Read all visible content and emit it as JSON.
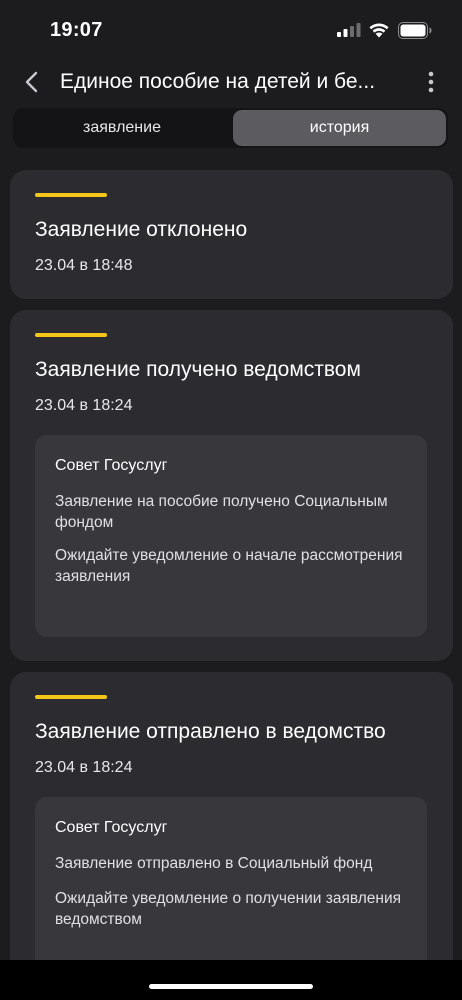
{
  "status_bar": {
    "time": "19:07"
  },
  "header": {
    "title": "Единое пособие на детей и бе...",
    "back_icon": "chevron-left-icon",
    "more_icon": "more-vertical-icon"
  },
  "tabs": [
    {
      "label": "заявление",
      "active": false
    },
    {
      "label": "история",
      "active": true
    }
  ],
  "colors": {
    "background": "#1c1c1e",
    "card": "#2c2c30",
    "advice_box": "#37373c",
    "accent_line": "#f5c518",
    "active_tab": "#5b5b60"
  },
  "events": [
    {
      "title": "Заявление отклонено",
      "time": "23.04 в 18:48"
    },
    {
      "title": "Заявление получено ведомством",
      "time": "23.04 в 18:24",
      "advice": {
        "title": "Совет Госуслуг",
        "paragraphs": [
          "Заявление на пособие получено Социальным фондом",
          "Ожидайте уведомление о начале рассмотрения заявления"
        ]
      }
    },
    {
      "title": "Заявление отправлено в ведомство",
      "time": "23.04 в 18:24",
      "advice": {
        "title": "Совет Госуслуг",
        "paragraphs": [
          "Заявление отправлено в Социальный фонд",
          "Ожидайте уведомление о получении заявления ведомством"
        ]
      }
    }
  ]
}
